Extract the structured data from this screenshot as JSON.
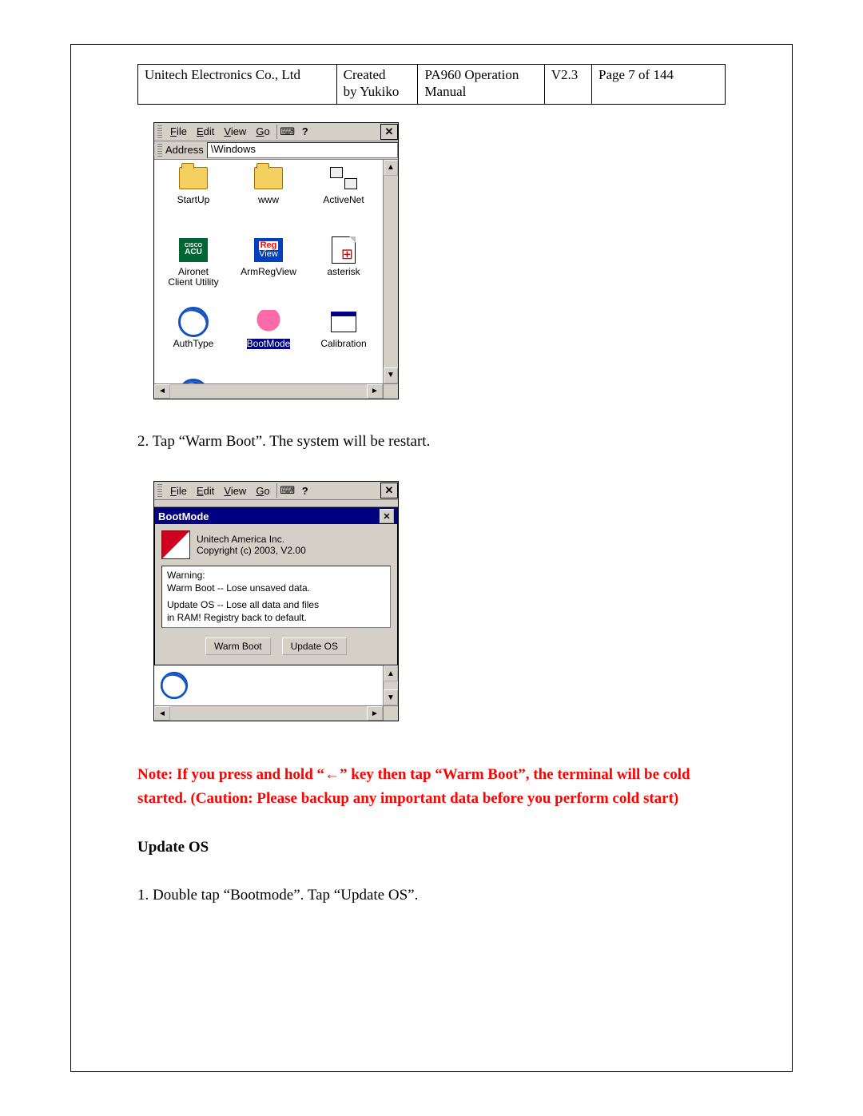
{
  "header": {
    "company": "Unitech Electronics Co., Ltd",
    "created_l1": "Created",
    "created_l2": "by Yukiko",
    "doc_l1": "PA960 Operation",
    "doc_l2": "Manual",
    "version": "V2.3",
    "page": "Page 7 of 144"
  },
  "ce": {
    "menus": {
      "file": "File",
      "edit": "Edit",
      "view": "View",
      "go": "Go"
    },
    "address_label": "Address",
    "address_value": "\\Windows",
    "icons": {
      "startup": "StartUp",
      "www": "www",
      "activenet": "ActiveNet",
      "aironet_l1": "Aironet",
      "aironet_l2": "Client Utility",
      "armregview": "ArmRegView",
      "asterisk": "asterisk",
      "authtype": "AuthType",
      "bootmode": "BootMode",
      "calibration": "Calibration"
    }
  },
  "step2_text": "2. Tap “Warm Boot”. The system will be restart.",
  "dialog": {
    "title": "BootMode",
    "company": "Unitech America Inc.",
    "copyright": "Copyright (c) 2003, V2.00",
    "warn_l1": "Warning:",
    "warn_l2": "Warm Boot -- Lose unsaved data.",
    "warn_l3": "Update OS -- Lose all data and files",
    "warn_l4": "in RAM! Registry back to default.",
    "btn_warm": "Warm Boot",
    "btn_update": "Update OS"
  },
  "note_text": "Note: If you press and hold “←” key then tap “Warm Boot”, the terminal will be cold started. (Caution: Please backup any important data before you perform cold start)",
  "update_heading": "Update OS",
  "update_step1": "1. Double tap “Bootmode”. Tap “Update OS”."
}
